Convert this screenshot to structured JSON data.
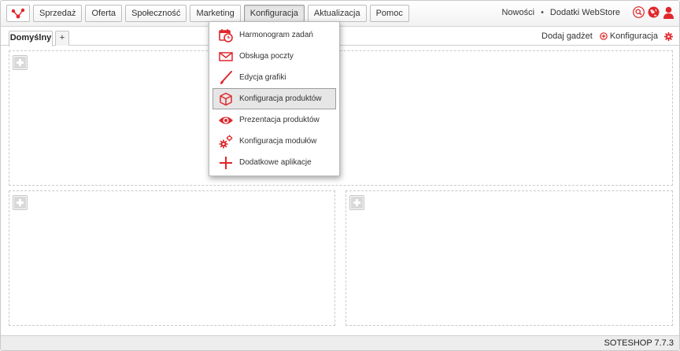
{
  "nav": {
    "logo": "soteshop-logo-icon",
    "items": [
      {
        "label": "Sprzedaż"
      },
      {
        "label": "Oferta"
      },
      {
        "label": "Społeczność"
      },
      {
        "label": "Marketing"
      },
      {
        "label": "Konfiguracja",
        "active": true
      },
      {
        "label": "Aktualizacja"
      },
      {
        "label": "Pomoc"
      }
    ],
    "right_links": [
      "Nowości",
      "Dodatki WebStore"
    ],
    "separator": "•",
    "icons": [
      "search-icon",
      "globe-icon",
      "user-icon"
    ]
  },
  "tabs": {
    "active_label": "Domyślny",
    "add_label": "+",
    "add_gadget_label": "Dodaj gadżet",
    "config_label": "Konfiguracja"
  },
  "dropdown": {
    "items": [
      {
        "label": "Harmonogram zadań",
        "icon": "calendar-clock-icon"
      },
      {
        "label": "Obsługa poczty",
        "icon": "envelope-icon"
      },
      {
        "label": "Edycja grafiki",
        "icon": "brush-icon"
      },
      {
        "label": "Konfiguracja produktów",
        "icon": "box-icon",
        "highlighted": true
      },
      {
        "label": "Prezentacja produktów",
        "icon": "eye-icon"
      },
      {
        "label": "Konfiguracja modułów",
        "icon": "gears-icon"
      },
      {
        "label": "Dodatkowe aplikacje",
        "icon": "plus-icon"
      }
    ]
  },
  "footer": {
    "version": "SOTESHOP 7.7.3"
  },
  "colors": {
    "accent": "#e0262b",
    "hover_bg": "#e6e6e6"
  }
}
